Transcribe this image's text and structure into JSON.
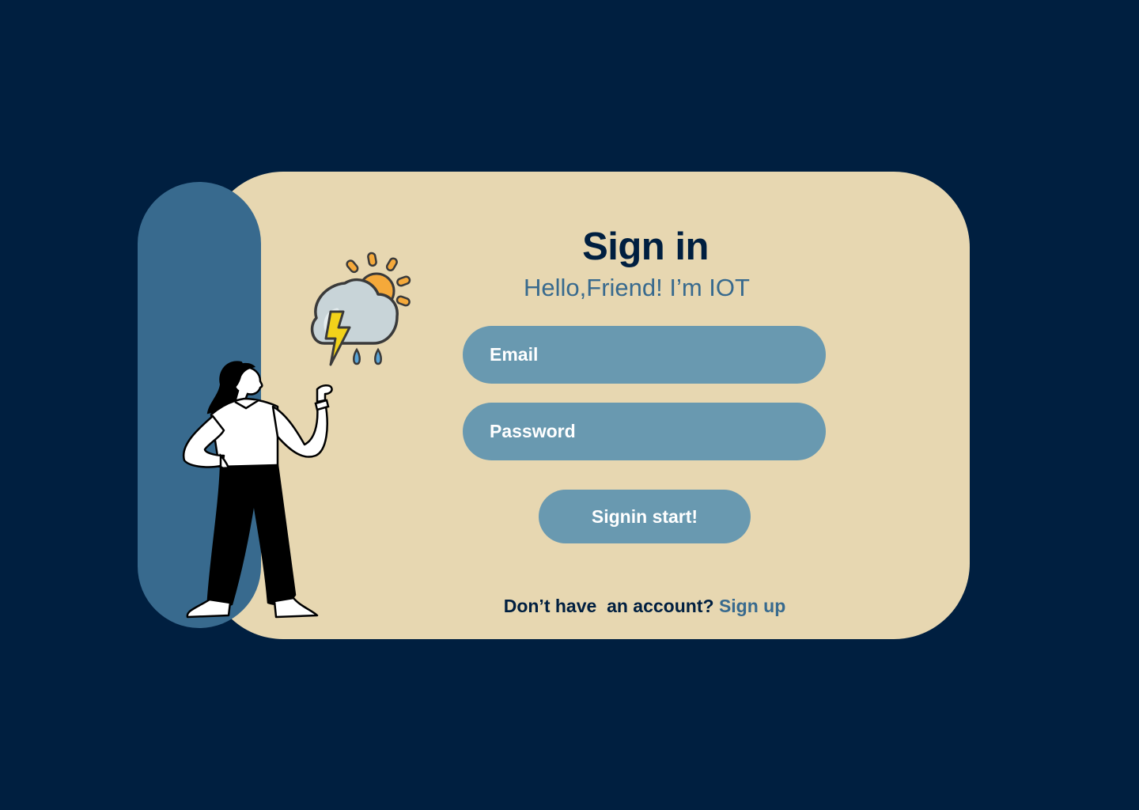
{
  "signin": {
    "title": "Sign in",
    "subtitle": "Hello,Friend! I’m IOT",
    "email_placeholder": "Email",
    "password_placeholder": "Password",
    "submit_label": "Signin start!",
    "footer_prompt": "Don’t have  an account? ",
    "signup_label": "Sign up"
  },
  "icons": {
    "weather": "weather-storm-sun-icon",
    "illustration": "woman-pointing-illustration"
  },
  "colors": {
    "background": "#001f40",
    "card": "#e7d7b1",
    "accent": "#386a8e",
    "field": "#6999b0",
    "heading": "#001f40"
  }
}
